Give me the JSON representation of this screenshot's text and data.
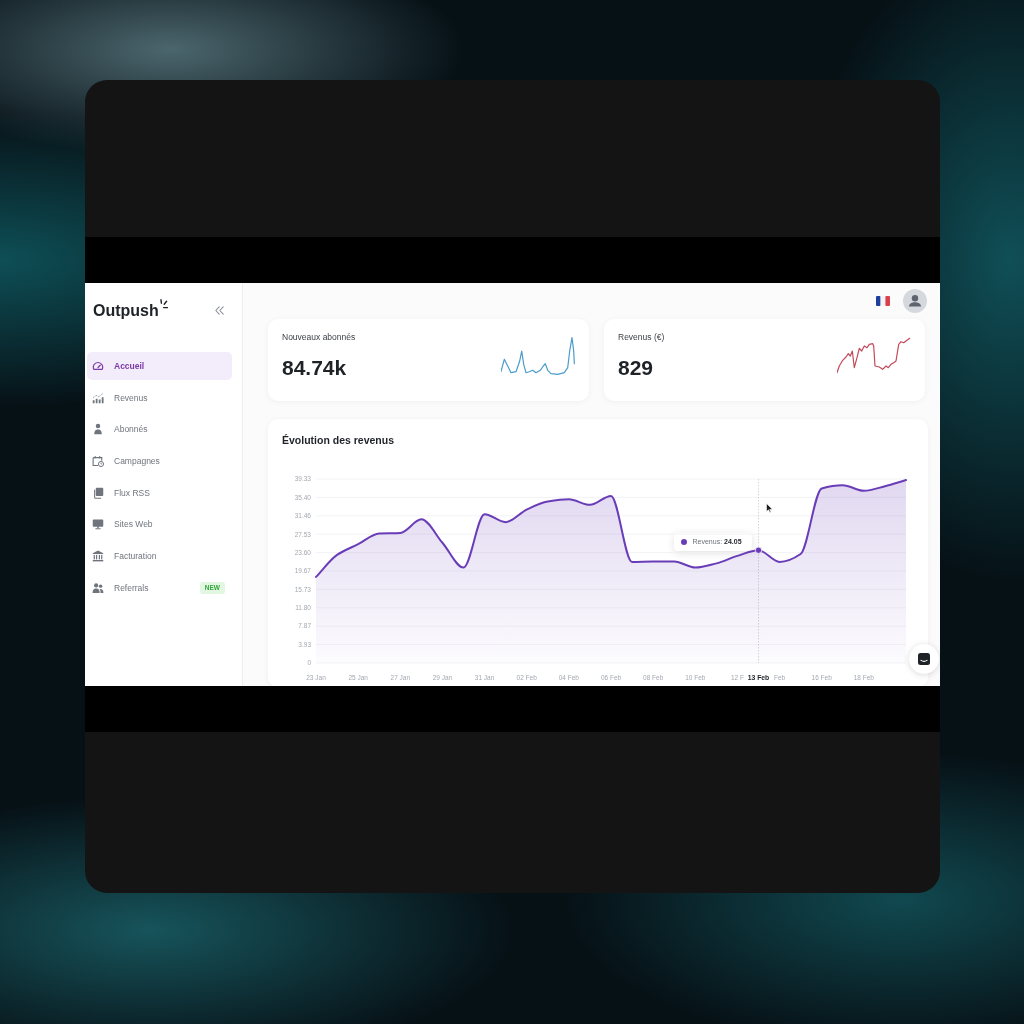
{
  "sidebar": {
    "logo": "Outpush",
    "items": [
      {
        "label": "Accueil",
        "selected": true
      },
      {
        "label": "Revenus",
        "selected": false
      },
      {
        "label": "Abonnés",
        "selected": false
      },
      {
        "label": "Campagnes",
        "selected": false
      },
      {
        "label": "Flux RSS",
        "selected": false
      },
      {
        "label": "Sites Web",
        "selected": false
      },
      {
        "label": "Facturation",
        "selected": false
      },
      {
        "label": "Referrals",
        "selected": false,
        "badge": "NEW"
      }
    ]
  },
  "stat_cards": [
    {
      "title": "Nouveaux abonnés",
      "value": "84.74k",
      "color": "#4a9ccb"
    },
    {
      "title": "Revenus (€)",
      "value": "829",
      "color": "#c2495a"
    }
  ],
  "revenue_chart": {
    "chart_data": {
      "type": "area",
      "title": "Évolution des revenus",
      "categories": [
        "23 Jan",
        null,
        "25 Jan",
        null,
        "27 Jan",
        null,
        "29 Jan",
        null,
        "31 Jan",
        null,
        "02 Feb",
        null,
        "04 Feb",
        null,
        "06 Feb",
        null,
        "08 Feb",
        null,
        "10 Feb",
        null,
        "12 F",
        "13 Feb",
        "Feb",
        null,
        "16 Feb",
        null,
        "18 Feb",
        null,
        null
      ],
      "series": [
        {
          "color": "#6a3db8",
          "values": [
            18.4,
            23.1,
            25.4,
            27.7,
            27.8,
            30.7,
            25.7,
            20.4,
            31.8,
            30.1,
            32.8,
            34.5,
            35.0,
            33.8,
            35.7,
            21.6,
            21.7,
            21.7,
            20.4,
            21.3,
            22.9,
            24.1,
            21.6,
            23.3,
            37.3,
            38.0,
            36.8,
            37.8,
            39.1
          ]
        }
      ],
      "ylim": [
        0,
        39.33
      ],
      "yticks": [
        {
          "value": 39.33,
          "label": "39.33"
        },
        {
          "value": 35.4,
          "label": "35.40"
        },
        {
          "value": 31.46,
          "label": "31.46"
        },
        {
          "value": 27.53,
          "label": "27.53"
        },
        {
          "value": 23.6,
          "label": "23.60"
        },
        {
          "value": 19.67,
          "label": "19.67"
        },
        {
          "value": 15.73,
          "label": "15.73"
        },
        {
          "value": 11.8,
          "label": "11.80"
        },
        {
          "value": 7.87,
          "label": "7.87"
        },
        {
          "value": 3.93,
          "label": "3.93"
        },
        {
          "value": 0,
          "label": "0"
        }
      ],
      "grid": true,
      "ref_lines": [
        {
          "axis": "x",
          "value": "13 Feb"
        }
      ],
      "annotations": [
        {
          "x": "13 Feb",
          "y": 24.1,
          "text": "Revenus: **24.05**"
        }
      ]
    }
  }
}
